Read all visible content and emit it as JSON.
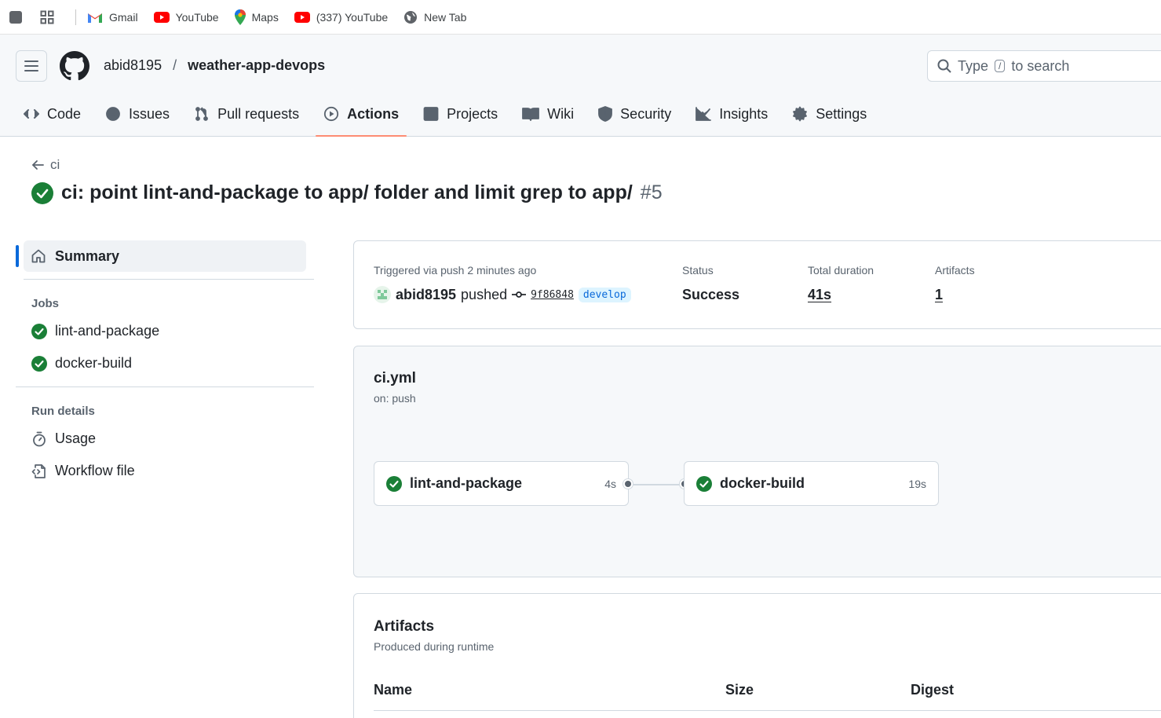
{
  "browser": {
    "bookmarks": [
      {
        "label": "Gmail",
        "icon": "gmail-icon"
      },
      {
        "label": "YouTube",
        "icon": "youtube-icon"
      },
      {
        "label": "Maps",
        "icon": "maps-icon"
      },
      {
        "label": "(337) YouTube",
        "icon": "youtube-icon"
      },
      {
        "label": "New Tab",
        "icon": "globe-icon"
      }
    ]
  },
  "header": {
    "owner": "abid8195",
    "separator": "/",
    "repo": "weather-app-devops",
    "search": {
      "prefix": "Type",
      "key": "/",
      "suffix": "to search"
    }
  },
  "tabs": [
    {
      "label": "Code",
      "icon": "code-icon"
    },
    {
      "label": "Issues",
      "icon": "issue-icon"
    },
    {
      "label": "Pull requests",
      "icon": "pull-request-icon"
    },
    {
      "label": "Actions",
      "icon": "play-icon",
      "active": true
    },
    {
      "label": "Projects",
      "icon": "table-icon"
    },
    {
      "label": "Wiki",
      "icon": "book-icon"
    },
    {
      "label": "Security",
      "icon": "shield-icon"
    },
    {
      "label": "Insights",
      "icon": "graph-icon"
    },
    {
      "label": "Settings",
      "icon": "gear-icon"
    }
  ],
  "run": {
    "back_label": "ci",
    "title": "ci: point lint-and-package to app/ folder and limit grep to app/",
    "number": "#5"
  },
  "sidebar": {
    "summary_label": "Summary",
    "jobs_heading": "Jobs",
    "jobs": [
      "lint-and-package",
      "docker-build"
    ],
    "run_details_heading": "Run details",
    "details": [
      {
        "label": "Usage",
        "icon": "stopwatch-icon"
      },
      {
        "label": "Workflow file",
        "icon": "file-code-icon"
      }
    ]
  },
  "summary": {
    "triggered_label": "Triggered via push 2 minutes ago",
    "actor": "abid8195",
    "action": "pushed",
    "sha": "9f86848",
    "branch": "develop",
    "status_label": "Status",
    "status_value": "Success",
    "duration_label": "Total duration",
    "duration_value": "41s",
    "artifacts_label": "Artifacts",
    "artifacts_value": "1"
  },
  "workflow": {
    "file": "ci.yml",
    "trigger": "on: push",
    "jobs": [
      {
        "name": "lint-and-package",
        "duration": "4s",
        "status": "success"
      },
      {
        "name": "docker-build",
        "duration": "19s",
        "status": "success"
      }
    ]
  },
  "artifacts": {
    "title": "Artifacts",
    "subtitle": "Produced during runtime",
    "columns": [
      "Name",
      "Size",
      "Digest"
    ]
  },
  "colors": {
    "success": "#1a7f37",
    "accent": "#0969da",
    "active_tab_underline": "#fd8c73"
  }
}
